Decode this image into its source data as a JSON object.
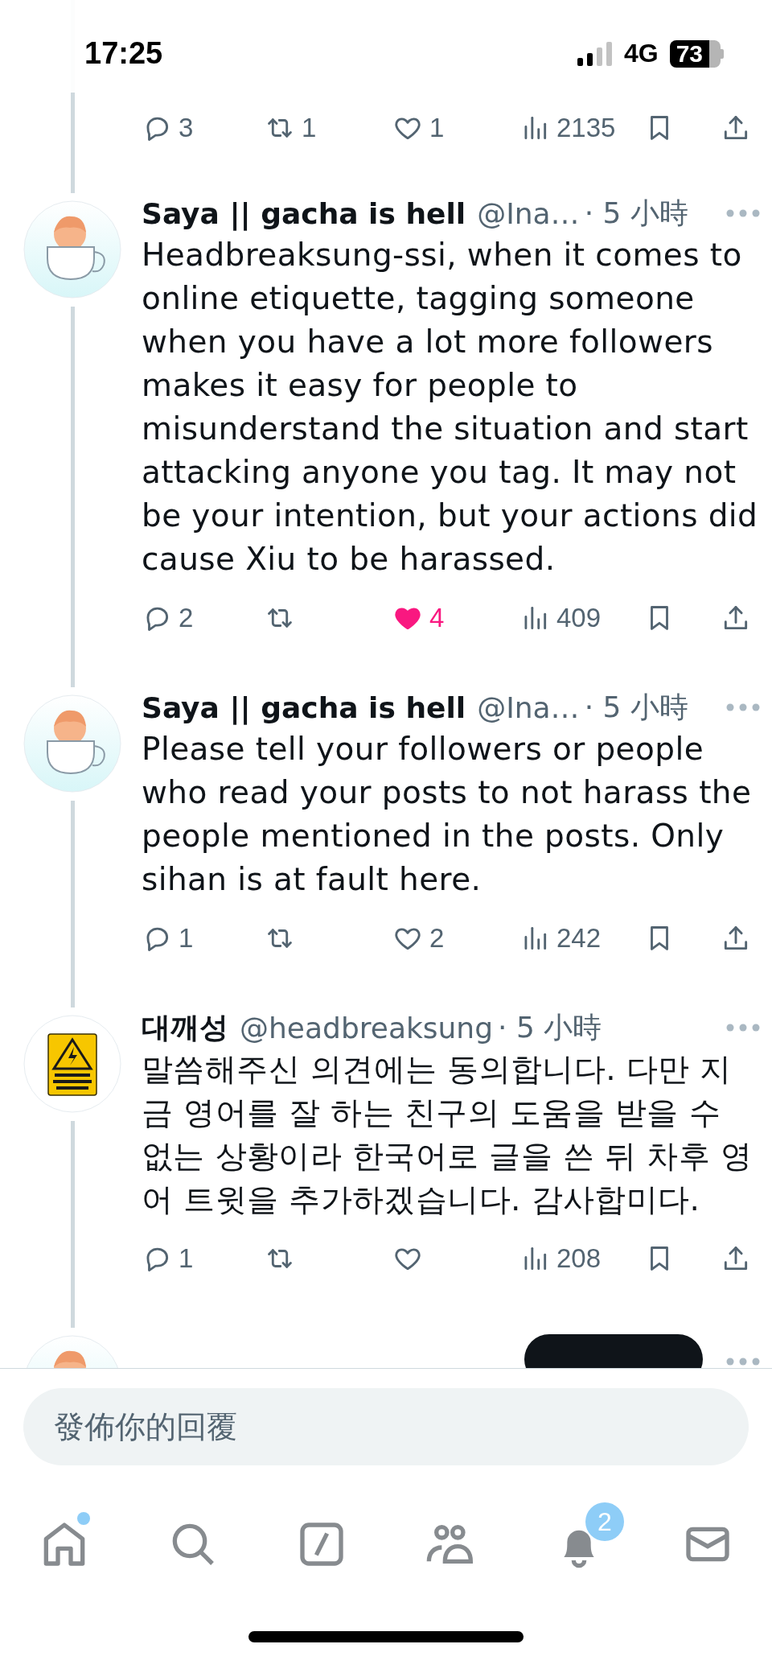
{
  "status_bar": {
    "time": "17:25",
    "network": "4G",
    "battery": "73"
  },
  "previous_stats": {
    "replies": "3",
    "reposts": "1",
    "likes": "1",
    "liked": false,
    "views": "2135"
  },
  "tweets": [
    {
      "kind": "cup",
      "name": "Saya || gacha is hell",
      "handle": "@Ina…",
      "time": "· 5 小時",
      "text": "Headbreaksung-ssi, when it comes to online etiquette, tagging someone when you have a lot more followers makes it easy for people to misunderstand the situation and start attacking anyone you tag. It may not be your intention, but your actions did cause Xiu to be harassed.",
      "stats": {
        "replies": "2",
        "likes": "4",
        "liked": true,
        "views": "409"
      }
    },
    {
      "kind": "cup",
      "name": "Saya || gacha is hell",
      "handle": "@Ina…",
      "time": "· 5 小時",
      "text": "Please tell your followers or people who read your posts to not harass the people mentioned in the posts. Only sihan is at fault here.",
      "stats": {
        "replies": "1",
        "likes": "2",
        "liked": false,
        "views": "242"
      }
    },
    {
      "kind": "sign",
      "name": "대깨성",
      "handle": "@headbreaksung",
      "time": "· 5 小時",
      "text": "말씀해주신 의견에는 동의합니다. 다만 지금 영어를 잘 하는 친구의 도움을 받을 수 없는 상황이라 한국어로 글을 쓴 뒤 차후 영어 트윗을 추가하겠습니다. 감사합미다.",
      "stats": {
        "replies": "1",
        "liked": false,
        "views": "208"
      }
    }
  ],
  "partial_tweet": {
    "kind": "cup"
  },
  "reply_field": {
    "placeholder": "發佈你的回覆"
  },
  "nav": [
    {
      "kind": "home",
      "dot": true
    },
    {
      "kind": "search",
      "dot": false
    },
    {
      "kind": "compose",
      "dot": false
    },
    {
      "kind": "communities",
      "dot": false
    },
    {
      "kind": "notifications",
      "dot": false,
      "badge": "2"
    },
    {
      "kind": "messages",
      "dot": false
    }
  ]
}
